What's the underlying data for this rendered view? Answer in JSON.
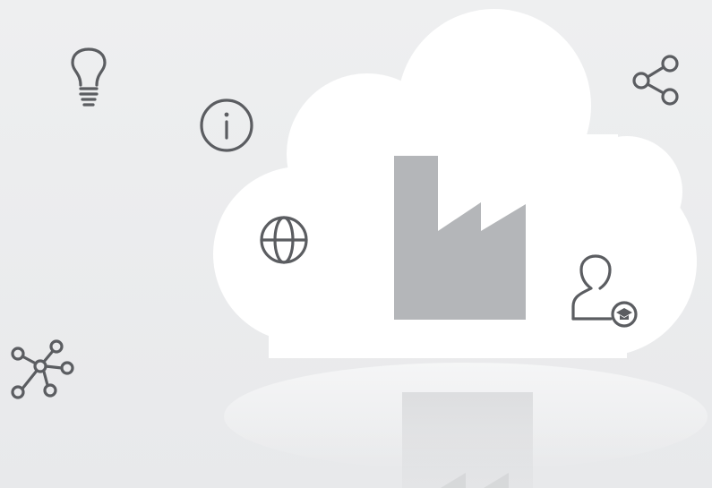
{
  "scene": {
    "background_top": "#eeeff0",
    "background_bottom": "#e8e9eb",
    "cloud_color": "#ffffff",
    "factory_color": "#b4b6b9",
    "icon_color": "#5b5d61",
    "central_graphic": "factory-in-cloud",
    "reflection": true
  },
  "icons": [
    "lightbulb-icon",
    "info-icon",
    "share-icon",
    "globe-icon",
    "user-education-icon",
    "network-icon"
  ]
}
